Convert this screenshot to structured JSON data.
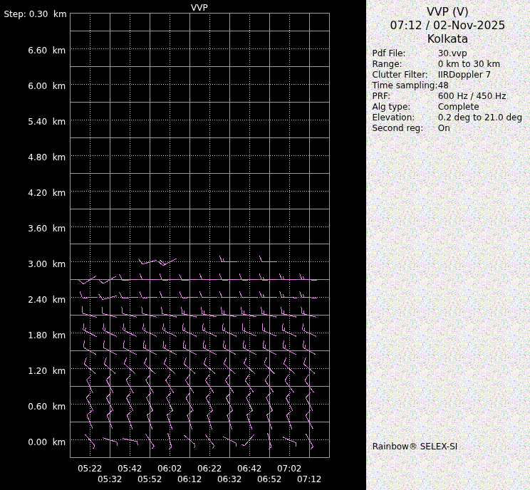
{
  "plot_title": "VVP",
  "axes": {
    "step_label": "Step: 0.30 km",
    "y_tick_labels": [
      "6.60 km",
      "6.00 km",
      "5.40 km",
      "4.80 km",
      "4.20 km",
      "3.60 km",
      "3.00 km",
      "2.40 km",
      "1.80 km",
      "1.20 km",
      "0.60 km",
      "0.00 km"
    ],
    "y_tick_km": [
      6.6,
      6.0,
      5.4,
      4.8,
      4.2,
      3.6,
      3.0,
      2.4,
      1.8,
      1.2,
      0.6,
      0.0
    ],
    "x_tick_labels_row1": [
      "05:22",
      "05:42",
      "06:02",
      "06:22",
      "06:42",
      "07:02"
    ],
    "x_tick_labels_row2": [
      "05:32",
      "05:52",
      "06:12",
      "06:32",
      "06:52",
      "07:12"
    ]
  },
  "panel": {
    "header_line1": "VVP (V)",
    "header_line2": "07:12 / 02-Nov-2025",
    "header_line3": "Kolkata",
    "params": [
      {
        "label": "Pdf File:",
        "value": "30.vvp"
      },
      {
        "label": "Range:",
        "value": "0 km to 30 km"
      },
      {
        "label": "Clutter Filter:",
        "value": "IIRDoppler 7"
      },
      {
        "label": "Time sampling:",
        "value": "48"
      },
      {
        "label": "PRF:",
        "value": "600 Hz / 450 Hz"
      },
      {
        "label": "Alg type:",
        "value": "Complete"
      },
      {
        "label": "Elevation:",
        "value": "0.2 deg to 21.0 deg"
      },
      {
        "label": "Second reg:",
        "value": "On"
      }
    ],
    "footer": "Rainbow® SELEX-SI"
  },
  "colors": {
    "background": "#000000",
    "grid_solid": "#9c9c9c",
    "grid_dotted": "#d0d0d0",
    "axis_text": "#ffffff",
    "barb": "#ee82ee",
    "panel_bg": "#ebebeb",
    "panel_text": "#000000"
  },
  "chart_data": {
    "type": "wind-barb-time-height-profile",
    "title": "VVP",
    "x_times": [
      "05:22",
      "05:32",
      "05:42",
      "05:52",
      "06:02",
      "06:12",
      "06:22",
      "06:32",
      "06:42",
      "06:52",
      "07:02",
      "07:12"
    ],
    "height_step_km": 0.3,
    "height_range_km": [
      0.0,
      6.6
    ],
    "barb_legend": "full tick = 10 kt, half tick = 5 kt; dir_deg is screen angle of staff from centre toward wind origin (0=right/E, 90=down/S, 180=left/W, 270=up/N)",
    "barbs": [
      {
        "ti": 3,
        "km": 3.0,
        "dir": 164,
        "ticks": [
          1
        ]
      },
      {
        "ti": 4,
        "km": 3.0,
        "dir": 152,
        "ticks": [
          1,
          1
        ]
      },
      {
        "ti": 7,
        "km": 3.0,
        "dir": 180,
        "ticks": [
          1,
          0.5
        ]
      },
      {
        "ti": 9,
        "km": 3.0,
        "dir": 180,
        "ticks": [
          1
        ]
      },
      {
        "ti": 0,
        "km": 2.7,
        "dir": 148,
        "ticks": [
          1
        ]
      },
      {
        "ti": 1,
        "km": 2.7,
        "dir": 150,
        "ticks": [
          1
        ]
      },
      {
        "ti": 2,
        "km": 2.7,
        "dir": 175,
        "ticks": [
          1
        ]
      },
      {
        "ti": 3,
        "km": 2.7,
        "dir": 180,
        "ticks": [
          1
        ]
      },
      {
        "ti": 4,
        "km": 2.7,
        "dir": 178,
        "ticks": [
          1
        ]
      },
      {
        "ti": 5,
        "km": 2.7,
        "dir": 176,
        "ticks": [
          1
        ]
      },
      {
        "ti": 6,
        "km": 2.7,
        "dir": 180,
        "ticks": [
          1
        ]
      },
      {
        "ti": 7,
        "km": 2.7,
        "dir": 178,
        "ticks": [
          1
        ]
      },
      {
        "ti": 8,
        "km": 2.7,
        "dir": 178,
        "ticks": [
          1
        ]
      },
      {
        "ti": 9,
        "km": 2.7,
        "dir": 178,
        "ticks": [
          1,
          0.5
        ]
      },
      {
        "ti": 10,
        "km": 2.7,
        "dir": 180,
        "ticks": [
          1,
          0.5
        ]
      },
      {
        "ti": 11,
        "km": 2.7,
        "dir": 182,
        "ticks": [
          1,
          0.5
        ]
      },
      {
        "ti": 0,
        "km": 2.4,
        "dir": 178,
        "ticks": [
          1
        ]
      },
      {
        "ti": 1,
        "km": 2.4,
        "dir": 165,
        "ticks": [
          1
        ]
      },
      {
        "ti": 2,
        "km": 2.4,
        "dir": 176,
        "ticks": [
          1
        ]
      },
      {
        "ti": 3,
        "km": 2.4,
        "dir": 178,
        "ticks": [
          1
        ]
      },
      {
        "ti": 4,
        "km": 2.4,
        "dir": 180,
        "ticks": [
          1
        ]
      },
      {
        "ti": 5,
        "km": 2.4,
        "dir": 178,
        "ticks": [
          1
        ]
      },
      {
        "ti": 6,
        "km": 2.4,
        "dir": 180,
        "ticks": [
          1
        ]
      },
      {
        "ti": 7,
        "km": 2.4,
        "dir": 180,
        "ticks": [
          1
        ]
      },
      {
        "ti": 8,
        "km": 2.4,
        "dir": 180,
        "ticks": [
          1
        ]
      },
      {
        "ti": 9,
        "km": 2.4,
        "dir": 180,
        "ticks": [
          1,
          0.5
        ]
      },
      {
        "ti": 10,
        "km": 2.4,
        "dir": 181,
        "ticks": [
          1,
          0.5
        ]
      },
      {
        "ti": 11,
        "km": 2.4,
        "dir": 182,
        "ticks": [
          1,
          0.5
        ]
      },
      {
        "ti": 0,
        "km": 2.1,
        "dir": 196,
        "ticks": [
          1
        ]
      },
      {
        "ti": 1,
        "km": 2.1,
        "dir": 195,
        "ticks": [
          1
        ]
      },
      {
        "ti": 2,
        "km": 2.1,
        "dir": 194,
        "ticks": [
          1
        ]
      },
      {
        "ti": 3,
        "km": 2.1,
        "dir": 194,
        "ticks": [
          1
        ]
      },
      {
        "ti": 4,
        "km": 2.1,
        "dir": 193,
        "ticks": [
          1
        ]
      },
      {
        "ti": 5,
        "km": 2.1,
        "dir": 193,
        "ticks": [
          1,
          0.5
        ]
      },
      {
        "ti": 6,
        "km": 2.1,
        "dir": 192,
        "ticks": [
          1,
          0.5
        ]
      },
      {
        "ti": 7,
        "km": 2.1,
        "dir": 192,
        "ticks": [
          1,
          0.5
        ]
      },
      {
        "ti": 8,
        "km": 2.1,
        "dir": 192,
        "ticks": [
          1,
          0.5
        ]
      },
      {
        "ti": 9,
        "km": 2.1,
        "dir": 193,
        "ticks": [
          1,
          0.5
        ]
      },
      {
        "ti": 10,
        "km": 2.1,
        "dir": 193,
        "ticks": [
          1,
          0.5
        ]
      },
      {
        "ti": 11,
        "km": 2.1,
        "dir": 194,
        "ticks": [
          1,
          0.5
        ]
      },
      {
        "ti": 0,
        "km": 1.8,
        "dir": 207,
        "ticks": [
          1,
          0.5
        ]
      },
      {
        "ti": 1,
        "km": 1.8,
        "dir": 206,
        "ticks": [
          1,
          0.5
        ]
      },
      {
        "ti": 2,
        "km": 1.8,
        "dir": 206,
        "ticks": [
          1,
          0.5
        ]
      },
      {
        "ti": 3,
        "km": 1.8,
        "dir": 205,
        "ticks": [
          1,
          0.5
        ]
      },
      {
        "ti": 4,
        "km": 1.8,
        "dir": 205,
        "ticks": [
          1,
          0.5
        ]
      },
      {
        "ti": 5,
        "km": 1.8,
        "dir": 204,
        "ticks": [
          1,
          0.5
        ]
      },
      {
        "ti": 6,
        "km": 1.8,
        "dir": 204,
        "ticks": [
          1,
          0.5
        ]
      },
      {
        "ti": 7,
        "km": 1.8,
        "dir": 204,
        "ticks": [
          1,
          0.5
        ]
      },
      {
        "ti": 8,
        "km": 1.8,
        "dir": 203,
        "ticks": [
          1,
          0.5
        ]
      },
      {
        "ti": 9,
        "km": 1.8,
        "dir": 203,
        "ticks": [
          1,
          0.5
        ]
      },
      {
        "ti": 10,
        "km": 1.8,
        "dir": 204,
        "ticks": [
          1,
          0.5
        ]
      },
      {
        "ti": 11,
        "km": 1.8,
        "dir": 205,
        "ticks": [
          1,
          0.5
        ]
      },
      {
        "ti": 0,
        "km": 1.5,
        "dir": 210,
        "ticks": [
          1
        ]
      },
      {
        "ti": 1,
        "km": 1.5,
        "dir": 209,
        "ticks": [
          1
        ]
      },
      {
        "ti": 2,
        "km": 1.5,
        "dir": 209,
        "ticks": [
          1
        ]
      },
      {
        "ti": 3,
        "km": 1.5,
        "dir": 209,
        "ticks": [
          1,
          0.5
        ]
      },
      {
        "ti": 4,
        "km": 1.5,
        "dir": 208,
        "ticks": [
          1,
          0.5
        ]
      },
      {
        "ti": 5,
        "km": 1.5,
        "dir": 209,
        "ticks": [
          1,
          0.5
        ]
      },
      {
        "ti": 6,
        "km": 1.5,
        "dir": 209,
        "ticks": [
          1,
          0.5
        ]
      },
      {
        "ti": 7,
        "km": 1.5,
        "dir": 210,
        "ticks": [
          1,
          0.5
        ]
      },
      {
        "ti": 8,
        "km": 1.5,
        "dir": 209,
        "ticks": [
          1,
          0.5
        ]
      },
      {
        "ti": 9,
        "km": 1.5,
        "dir": 209,
        "ticks": [
          1,
          0.5
        ]
      },
      {
        "ti": 10,
        "km": 1.5,
        "dir": 209,
        "ticks": [
          1,
          0.5
        ]
      },
      {
        "ti": 11,
        "km": 1.5,
        "dir": 210,
        "ticks": [
          1,
          0.5
        ]
      },
      {
        "ti": 0,
        "km": 1.2,
        "dir": 221,
        "ticks": [
          1
        ]
      },
      {
        "ti": 1,
        "km": 1.2,
        "dir": 221,
        "ticks": [
          1
        ]
      },
      {
        "ti": 2,
        "km": 1.2,
        "dir": 222,
        "ticks": [
          1
        ]
      },
      {
        "ti": 3,
        "km": 1.2,
        "dir": 223,
        "ticks": [
          1
        ]
      },
      {
        "ti": 4,
        "km": 1.2,
        "dir": 222,
        "ticks": [
          1
        ]
      },
      {
        "ti": 5,
        "km": 1.2,
        "dir": 221,
        "ticks": [
          1
        ]
      },
      {
        "ti": 6,
        "km": 1.2,
        "dir": 221,
        "ticks": [
          1
        ]
      },
      {
        "ti": 7,
        "km": 1.2,
        "dir": 222,
        "ticks": [
          1
        ]
      },
      {
        "ti": 8,
        "km": 1.2,
        "dir": 223,
        "ticks": [
          1
        ]
      },
      {
        "ti": 9,
        "km": 1.2,
        "dir": 224,
        "ticks": [
          1
        ]
      },
      {
        "ti": 10,
        "km": 1.2,
        "dir": 222,
        "ticks": [
          1
        ]
      },
      {
        "ti": 11,
        "km": 1.2,
        "dir": 221,
        "ticks": [
          1
        ]
      },
      {
        "ti": 0,
        "km": 0.9,
        "dir": 245,
        "ticks": [
          1
        ]
      },
      {
        "ti": 1,
        "km": 0.9,
        "dir": 243,
        "ticks": [
          1
        ]
      },
      {
        "ti": 2,
        "km": 0.9,
        "dir": 241,
        "ticks": [
          1
        ]
      },
      {
        "ti": 3,
        "km": 0.9,
        "dir": 239,
        "ticks": [
          1
        ]
      },
      {
        "ti": 4,
        "km": 0.9,
        "dir": 238,
        "ticks": [
          1
        ]
      },
      {
        "ti": 5,
        "km": 0.9,
        "dir": 237,
        "ticks": [
          1
        ]
      },
      {
        "ti": 6,
        "km": 0.9,
        "dir": 236,
        "ticks": [
          1
        ]
      },
      {
        "ti": 7,
        "km": 0.9,
        "dir": 236,
        "ticks": [
          1
        ]
      },
      {
        "ti": 8,
        "km": 0.9,
        "dir": 235,
        "ticks": [
          1
        ]
      },
      {
        "ti": 9,
        "km": 0.9,
        "dir": 234,
        "ticks": [
          1
        ]
      },
      {
        "ti": 10,
        "km": 0.9,
        "dir": 233,
        "ticks": [
          1
        ]
      },
      {
        "ti": 11,
        "km": 0.9,
        "dir": 233,
        "ticks": [
          1
        ]
      },
      {
        "ti": 0,
        "km": 0.6,
        "dir": 242,
        "ticks": [
          1
        ]
      },
      {
        "ti": 1,
        "km": 0.6,
        "dir": 243,
        "ticks": [
          1
        ]
      },
      {
        "ti": 2,
        "km": 0.6,
        "dir": 243,
        "ticks": [
          1
        ]
      },
      {
        "ti": 3,
        "km": 0.6,
        "dir": 244,
        "ticks": [
          1
        ]
      },
      {
        "ti": 4,
        "km": 0.6,
        "dir": 244,
        "ticks": [
          1
        ]
      },
      {
        "ti": 5,
        "km": 0.6,
        "dir": 240,
        "ticks": [
          1
        ]
      },
      {
        "ti": 6,
        "km": 0.6,
        "dir": 242,
        "ticks": [
          1
        ]
      },
      {
        "ti": 7,
        "km": 0.6,
        "dir": 243,
        "ticks": [
          1
        ]
      },
      {
        "ti": 8,
        "km": 0.6,
        "dir": 244,
        "ticks": [
          1
        ]
      },
      {
        "ti": 9,
        "km": 0.6,
        "dir": 244,
        "ticks": [
          1
        ]
      },
      {
        "ti": 10,
        "km": 0.6,
        "dir": 243,
        "ticks": [
          1
        ]
      },
      {
        "ti": 11,
        "km": 0.6,
        "dir": 242,
        "ticks": [
          1
        ]
      },
      {
        "ti": 0,
        "km": 0.3,
        "dir": 247,
        "ticks": [
          1
        ]
      },
      {
        "ti": 1,
        "km": 0.3,
        "dir": 248,
        "ticks": [
          1
        ]
      },
      {
        "ti": 2,
        "km": 0.3,
        "dir": 249,
        "ticks": [
          1
        ]
      },
      {
        "ti": 3,
        "km": 0.3,
        "dir": 250,
        "ticks": [
          1
        ]
      },
      {
        "ti": 4,
        "km": 0.3,
        "dir": 250,
        "ticks": [
          1
        ]
      },
      {
        "ti": 5,
        "km": 0.3,
        "dir": 251,
        "ticks": [
          1
        ]
      },
      {
        "ti": 6,
        "km": 0.3,
        "dir": 251,
        "ticks": [
          1
        ]
      },
      {
        "ti": 7,
        "km": 0.3,
        "dir": 251,
        "ticks": [
          1
        ]
      },
      {
        "ti": 8,
        "km": 0.3,
        "dir": 250,
        "ticks": [
          1
        ]
      },
      {
        "ti": 9,
        "km": 0.3,
        "dir": 250,
        "ticks": [
          1
        ]
      },
      {
        "ti": 10,
        "km": 0.3,
        "dir": 249,
        "ticks": [
          1
        ]
      },
      {
        "ti": 11,
        "km": 0.3,
        "dir": 241,
        "ticks": [
          1
        ]
      },
      {
        "ti": 0,
        "km": 0.0,
        "dir": 49,
        "ticks": [
          0.5
        ]
      },
      {
        "ti": 1,
        "km": 0.0,
        "dir": 17,
        "ticks": [
          0.5
        ]
      },
      {
        "ti": 2,
        "km": 0.0,
        "dir": 12,
        "ticks": [
          0.5
        ]
      },
      {
        "ti": 3,
        "km": 0.0,
        "dir": 55,
        "ticks": [
          0.5
        ]
      },
      {
        "ti": 4,
        "km": 0.0,
        "dir": 75,
        "ticks": [
          0.5
        ]
      },
      {
        "ti": 5,
        "km": 0.0,
        "dir": 40,
        "ticks": [
          0.5
        ]
      },
      {
        "ti": 6,
        "km": 0.0,
        "dir": 51,
        "ticks": [
          0.5
        ]
      },
      {
        "ti": 7,
        "km": 0.0,
        "dir": 27,
        "ticks": [
          0.5
        ]
      },
      {
        "ti": 8,
        "km": 0.0,
        "dir": 131,
        "ticks": [
          0.5
        ]
      },
      {
        "ti": 9,
        "km": 0.0,
        "dir": 75,
        "ticks": [
          0.5
        ]
      },
      {
        "ti": 10,
        "km": 0.0,
        "dir": 23,
        "ticks": [
          0.5
        ]
      },
      {
        "ti": 11,
        "km": 0.0,
        "dir": 60,
        "ticks": [
          0.5
        ]
      }
    ]
  }
}
